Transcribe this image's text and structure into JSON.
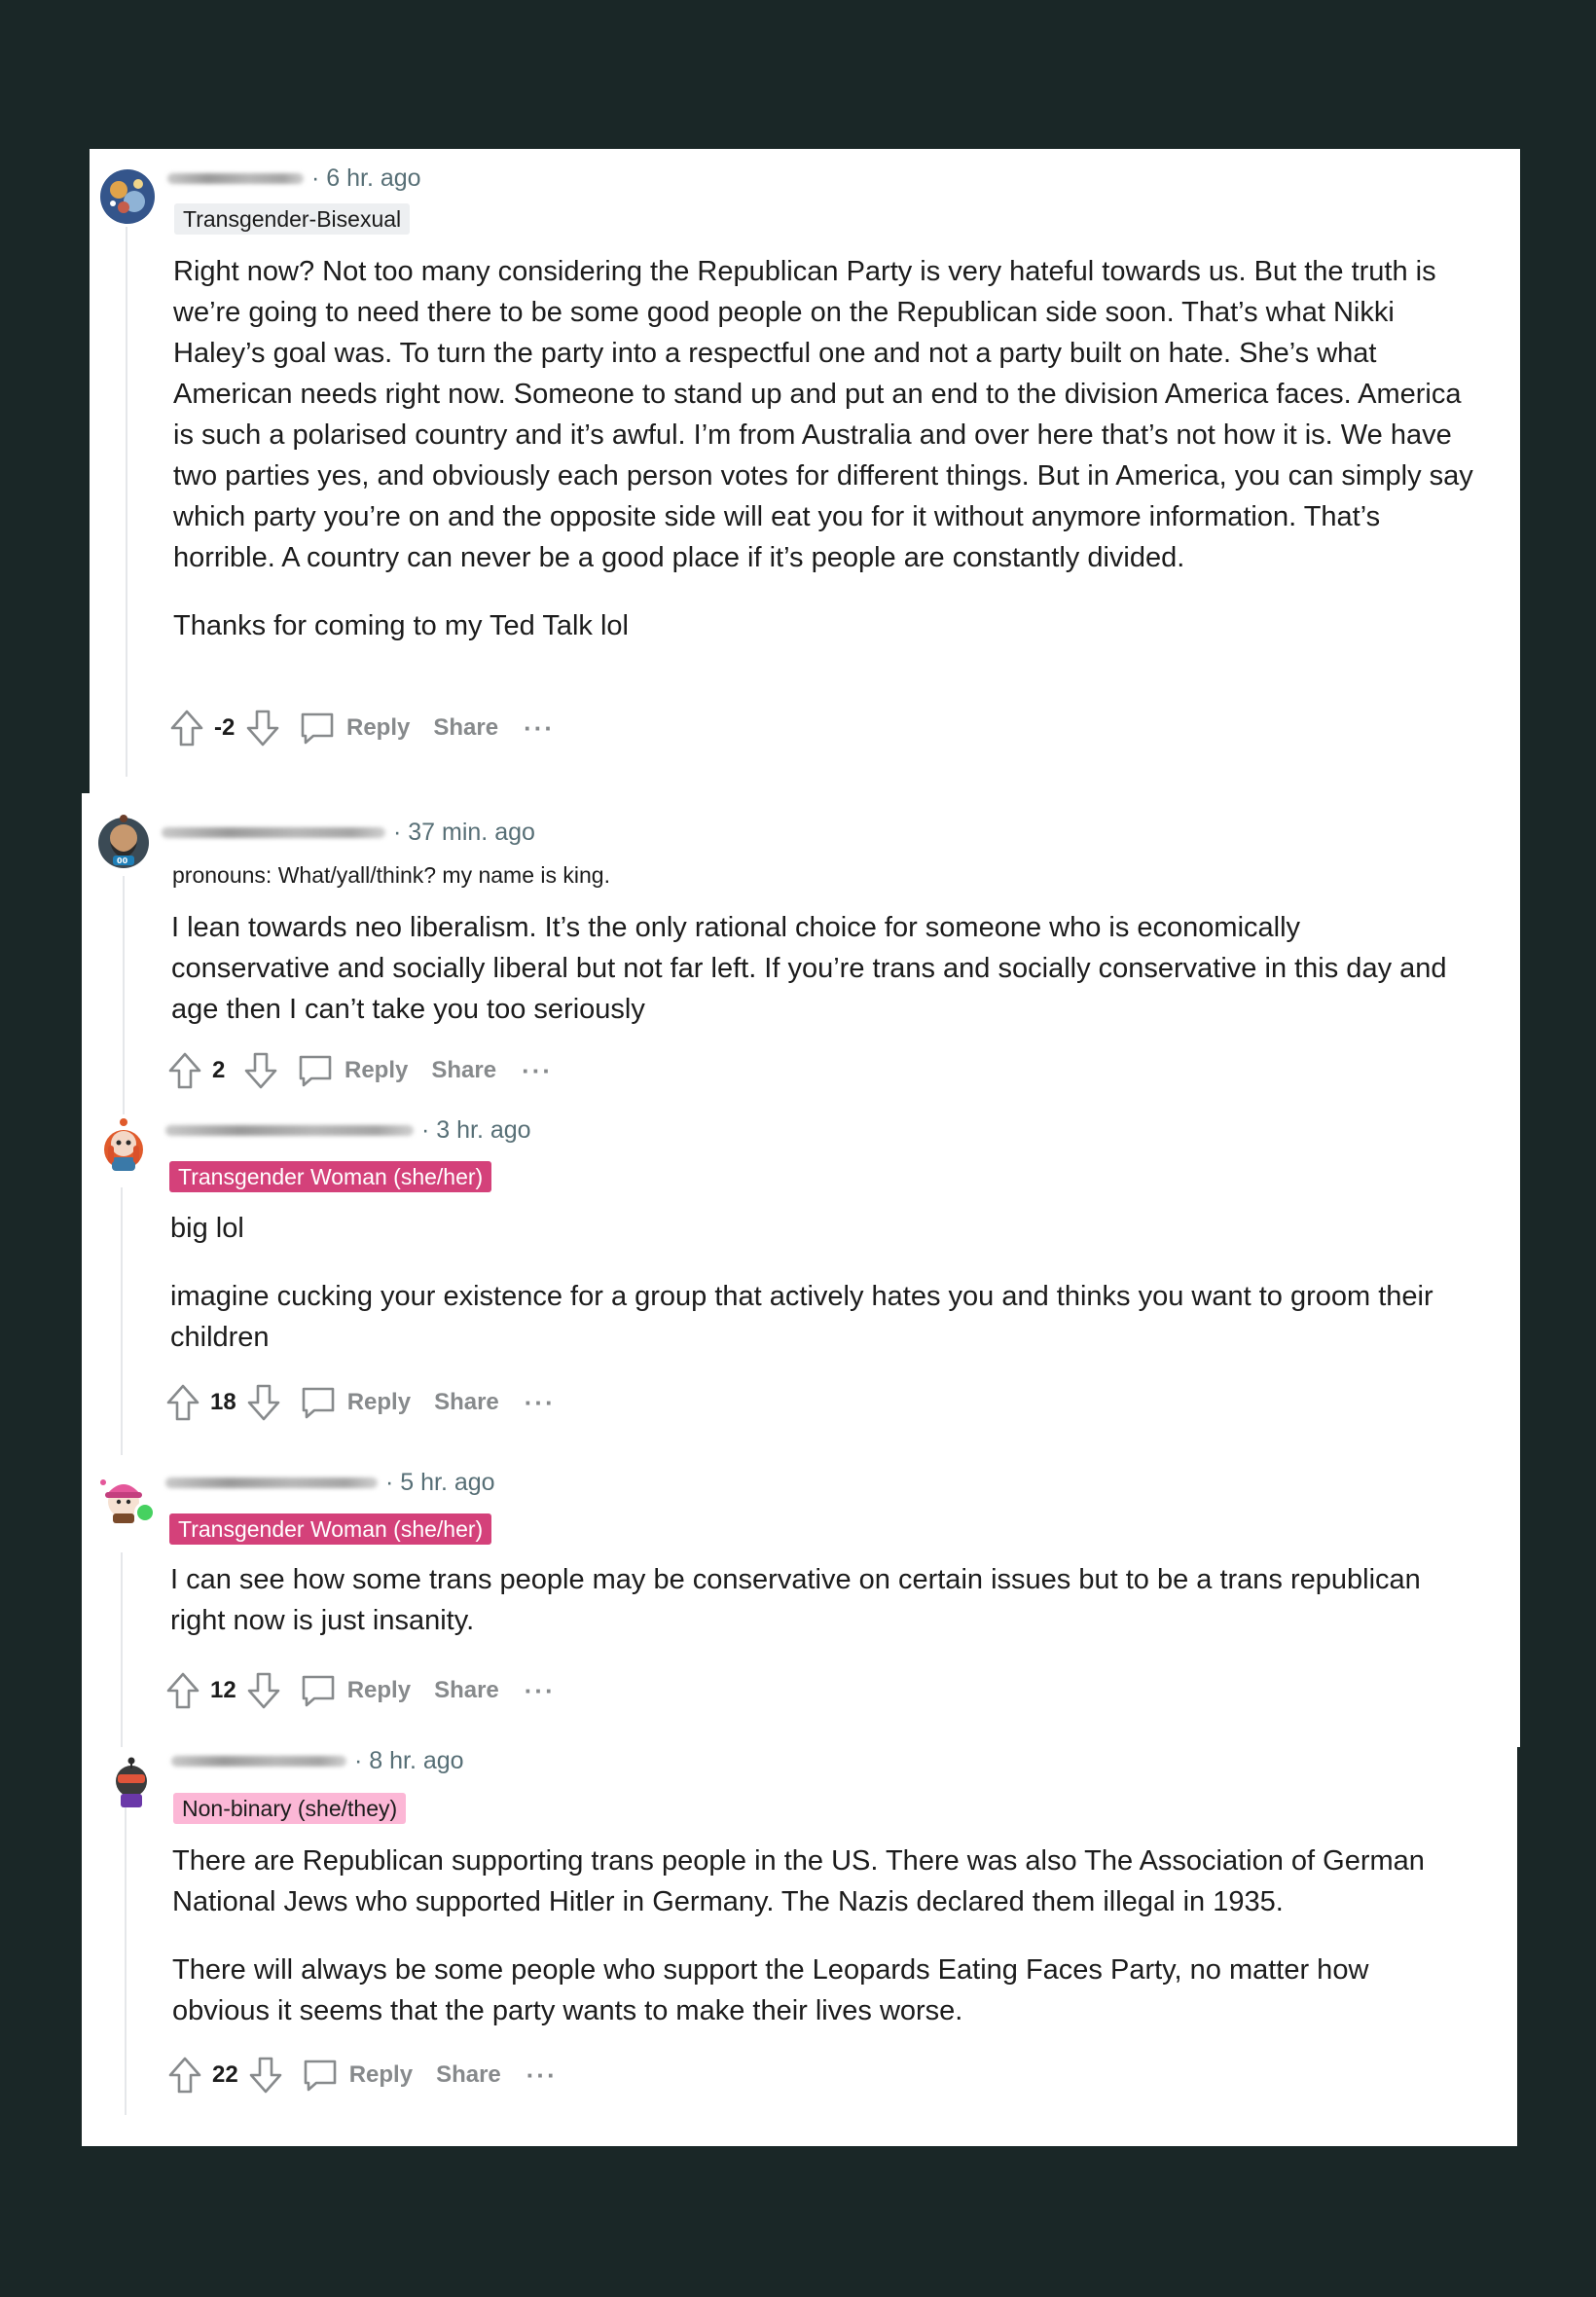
{
  "colors": {
    "background": "#1a2727",
    "card": "#ffffff",
    "flair_pink": "#d4417a",
    "flair_light_pink": "#fcb7d6",
    "flair_grey": "#edeff1",
    "online": "#46d160"
  },
  "comments": [
    {
      "time": "· 6 hr. ago",
      "flair": "Transgender-Bisexual",
      "paragraphs": [
        "Right now? Not too many considering the Republican Party is very hateful towards us. But the truth is we’re going to need there to be some good people on the Republican side soon. That’s what Nikki Haley’s goal was. To turn the party into a respectful one and not a party built on hate. She’s what American needs right now. Someone to stand up and put an end to the division America faces. America is such a polarised country and it’s awful. I’m from Australia and over here that’s not how it is. We have two parties yes, and obviously each person votes for different things. But in America, you can simply say which party you’re on and the opposite side will eat you for it without anymore information. That’s horrible. A country can never be a good place if it’s people are constantly divided.",
        "Thanks for coming to my Ted Talk lol"
      ],
      "score": "-2",
      "reply": "Reply",
      "share": "Share",
      "more": "···",
      "avatar_icon": "planet-avatar-icon"
    },
    {
      "time": "· 37 min. ago",
      "flair": "pronouns: What/yall/think? my name is king.",
      "paragraphs": [
        "I lean towards neo liberalism. It’s the only rational choice for someone who is economically conservative and socially liberal but not far left. If you’re trans and socially conservative in this day and age then I can’t take you too seriously"
      ],
      "score": "2",
      "reply": "Reply",
      "share": "Share",
      "more": "···",
      "avatar_icon": "bearded-snoo-avatar-icon"
    },
    {
      "time": "· 3 hr. ago",
      "flair": "Transgender Woman (she/her)",
      "paragraphs": [
        "big lol",
        "imagine cucking your existence for a group that actively hates you and thinks you want to groom their children"
      ],
      "score": "18",
      "reply": "Reply",
      "share": "Share",
      "more": "···",
      "avatar_icon": "redhead-snoo-avatar-icon"
    },
    {
      "time": "· 5 hr. ago",
      "flair": "Transgender Woman (she/her)",
      "paragraphs": [
        "I can see how some trans people may be conservative on certain issues but to be a trans republican right now is just insanity."
      ],
      "score": "12",
      "reply": "Reply",
      "share": "Share",
      "more": "···",
      "avatar_icon": "pink-cap-snoo-avatar-icon"
    },
    {
      "time": "· 8 hr. ago",
      "flair": "Non-binary (she/they)",
      "paragraphs": [
        "There are Republican supporting trans people in the US. There was also The Association of German National Jews who supported Hitler in Germany. The Nazis declared them illegal in 1935.",
        "There will always be some people who support the Leopards Eating Faces Party, no matter how obvious it seems that the party wants to make their lives worse."
      ],
      "score": "22",
      "reply": "Reply",
      "share": "Share",
      "more": "···",
      "avatar_icon": "dark-robot-snoo-avatar-icon"
    }
  ]
}
